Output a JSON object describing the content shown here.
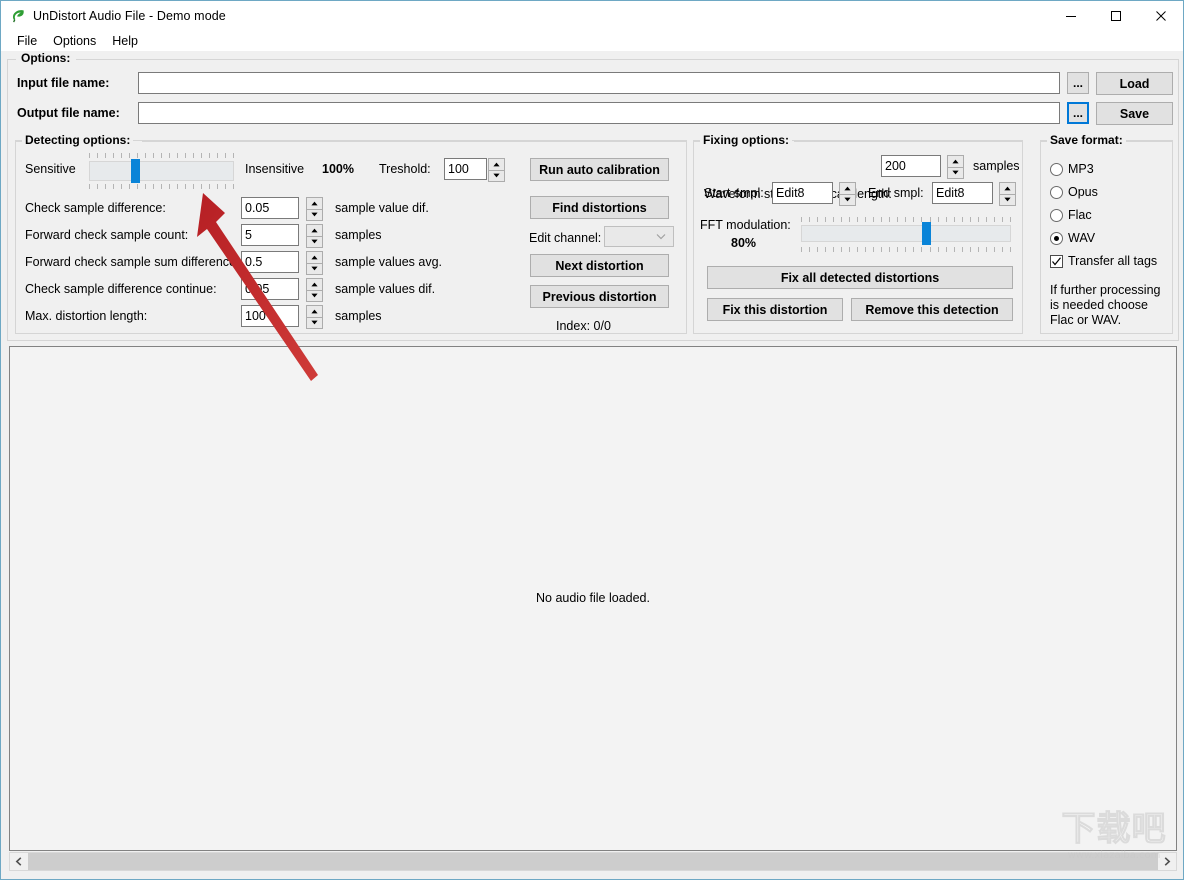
{
  "window": {
    "title": "UnDistort Audio File - Demo mode",
    "icon": "app-leaf-icon",
    "controls": {
      "minimize": "minimize-icon",
      "maximize": "maximize-icon",
      "close": "close-icon"
    }
  },
  "menubar": {
    "items": [
      {
        "label": "File"
      },
      {
        "label": "Options"
      },
      {
        "label": "Help"
      }
    ]
  },
  "options_group": {
    "title": "Options:",
    "input_file": {
      "label": "Input file name:",
      "value": "",
      "placeholder": "",
      "browse_label": "...",
      "action_label": "Load"
    },
    "output_file": {
      "label": "Output file name:",
      "value": "",
      "placeholder": "",
      "browse_label": "...",
      "action_label": "Save"
    }
  },
  "detecting_options": {
    "title": "Detecting options:",
    "sensitivity": {
      "left_label": "Sensitive",
      "right_label": "Insensitive",
      "percent_label": "100%",
      "value": 100,
      "thumb_position_pct": 31
    },
    "threshold": {
      "label": "Treshold:",
      "value": "100"
    },
    "fields": [
      {
        "label": "Check sample difference:",
        "value": "0.05",
        "unit": "sample value dif."
      },
      {
        "label": "Forward check sample count:",
        "value": "5",
        "unit": "samples"
      },
      {
        "label": "Forward check sample sum difference:",
        "value": "0.5",
        "unit": "sample values avg."
      },
      {
        "label": "Check sample difference continue:",
        "value": "0.05",
        "unit": "sample values dif."
      },
      {
        "label": "Max. distortion length:",
        "value": "100",
        "unit": "samples"
      }
    ],
    "buttons": {
      "run_auto_calibration": "Run auto calibration",
      "find_distortions": "Find distortions",
      "next_distortion": "Next distortion",
      "previous_distortion": "Previous distortion"
    },
    "edit_channel": {
      "label": "Edit channel:",
      "value": "",
      "enabled": false
    },
    "index_label": "Index: 0/0"
  },
  "fixing_options": {
    "title": "Fixing options:",
    "scan_length": {
      "label": "Waveform steepness scan length:",
      "value": "200",
      "unit": "samples"
    },
    "start_smpl": {
      "label": "Start smpl:",
      "value": "Edit8"
    },
    "end_smpl": {
      "label": "End smpl:",
      "value": "Edit8"
    },
    "fft_modulation": {
      "label": "FFT modulation:",
      "percent_label": "80%",
      "value": 80,
      "thumb_position_pct": 60
    },
    "buttons": {
      "fix_all": "Fix all detected distortions",
      "fix_this": "Fix this distortion",
      "remove_detection": "Remove this detection"
    }
  },
  "save_format": {
    "title": "Save format:",
    "options": [
      {
        "label": "MP3",
        "selected": false
      },
      {
        "label": "Opus",
        "selected": false
      },
      {
        "label": "Flac",
        "selected": false
      },
      {
        "label": "WAV",
        "selected": true
      }
    ],
    "transfer_tags": {
      "label": "Transfer all tags",
      "checked": true
    },
    "note": "If further processing is needed choose Flac or WAV."
  },
  "canvas": {
    "message": "No audio file loaded."
  },
  "scrollbar": {
    "left_arrow": "chevron-left-icon",
    "right_arrow": "chevron-right-icon"
  },
  "watermark": {
    "text": "下载吧",
    "url": "www.xiazaiba.com"
  },
  "colors": {
    "accent": "#0a84d8",
    "focus": "#0078d7",
    "window_border": "#6ea8c4",
    "face": "#f0f0f0",
    "button_face": "#e1e1e1",
    "annotation": "#c0272d"
  }
}
